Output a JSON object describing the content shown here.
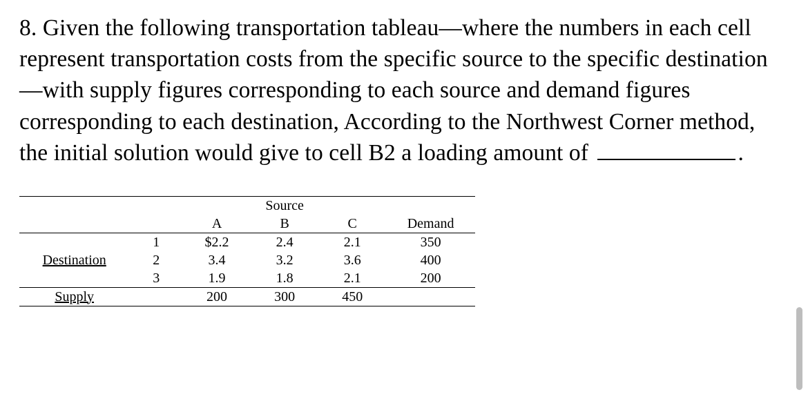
{
  "question": {
    "number": "8.",
    "text": "Given the following transportation tableau—where the numbers in each cell represent transportation costs from the specific source to the specific destination—with supply figures corresponding to each source and demand figures corresponding to each destination, According to the Northwest Corner method, the initial solution would give to cell B2 a loading amount of",
    "trailing_period": "."
  },
  "table": {
    "source_header": "Source",
    "cols": {
      "A": "A",
      "B": "B",
      "C": "C"
    },
    "demand_header": "Demand",
    "destination_label": "Destination",
    "supply_label": "Supply",
    "rows": [
      {
        "id": "1",
        "A": "$2.2",
        "B": "2.4",
        "C": "2.1",
        "demand": "350"
      },
      {
        "id": "2",
        "A": "3.4",
        "B": "3.2",
        "C": "3.6",
        "demand": "400"
      },
      {
        "id": "3",
        "A": "1.9",
        "B": "1.8",
        "C": "2.1",
        "demand": "200"
      }
    ],
    "supply": {
      "A": "200",
      "B": "300",
      "C": "450"
    }
  },
  "chart_data": {
    "type": "table",
    "title": "Transportation tableau",
    "sources": [
      "A",
      "B",
      "C"
    ],
    "destinations": [
      "1",
      "2",
      "3"
    ],
    "costs": [
      [
        2.2,
        2.4,
        2.1
      ],
      [
        3.4,
        3.2,
        3.6
      ],
      [
        1.9,
        1.8,
        2.1
      ]
    ],
    "demand": [
      350,
      400,
      200
    ],
    "supply": [
      200,
      300,
      450
    ]
  }
}
